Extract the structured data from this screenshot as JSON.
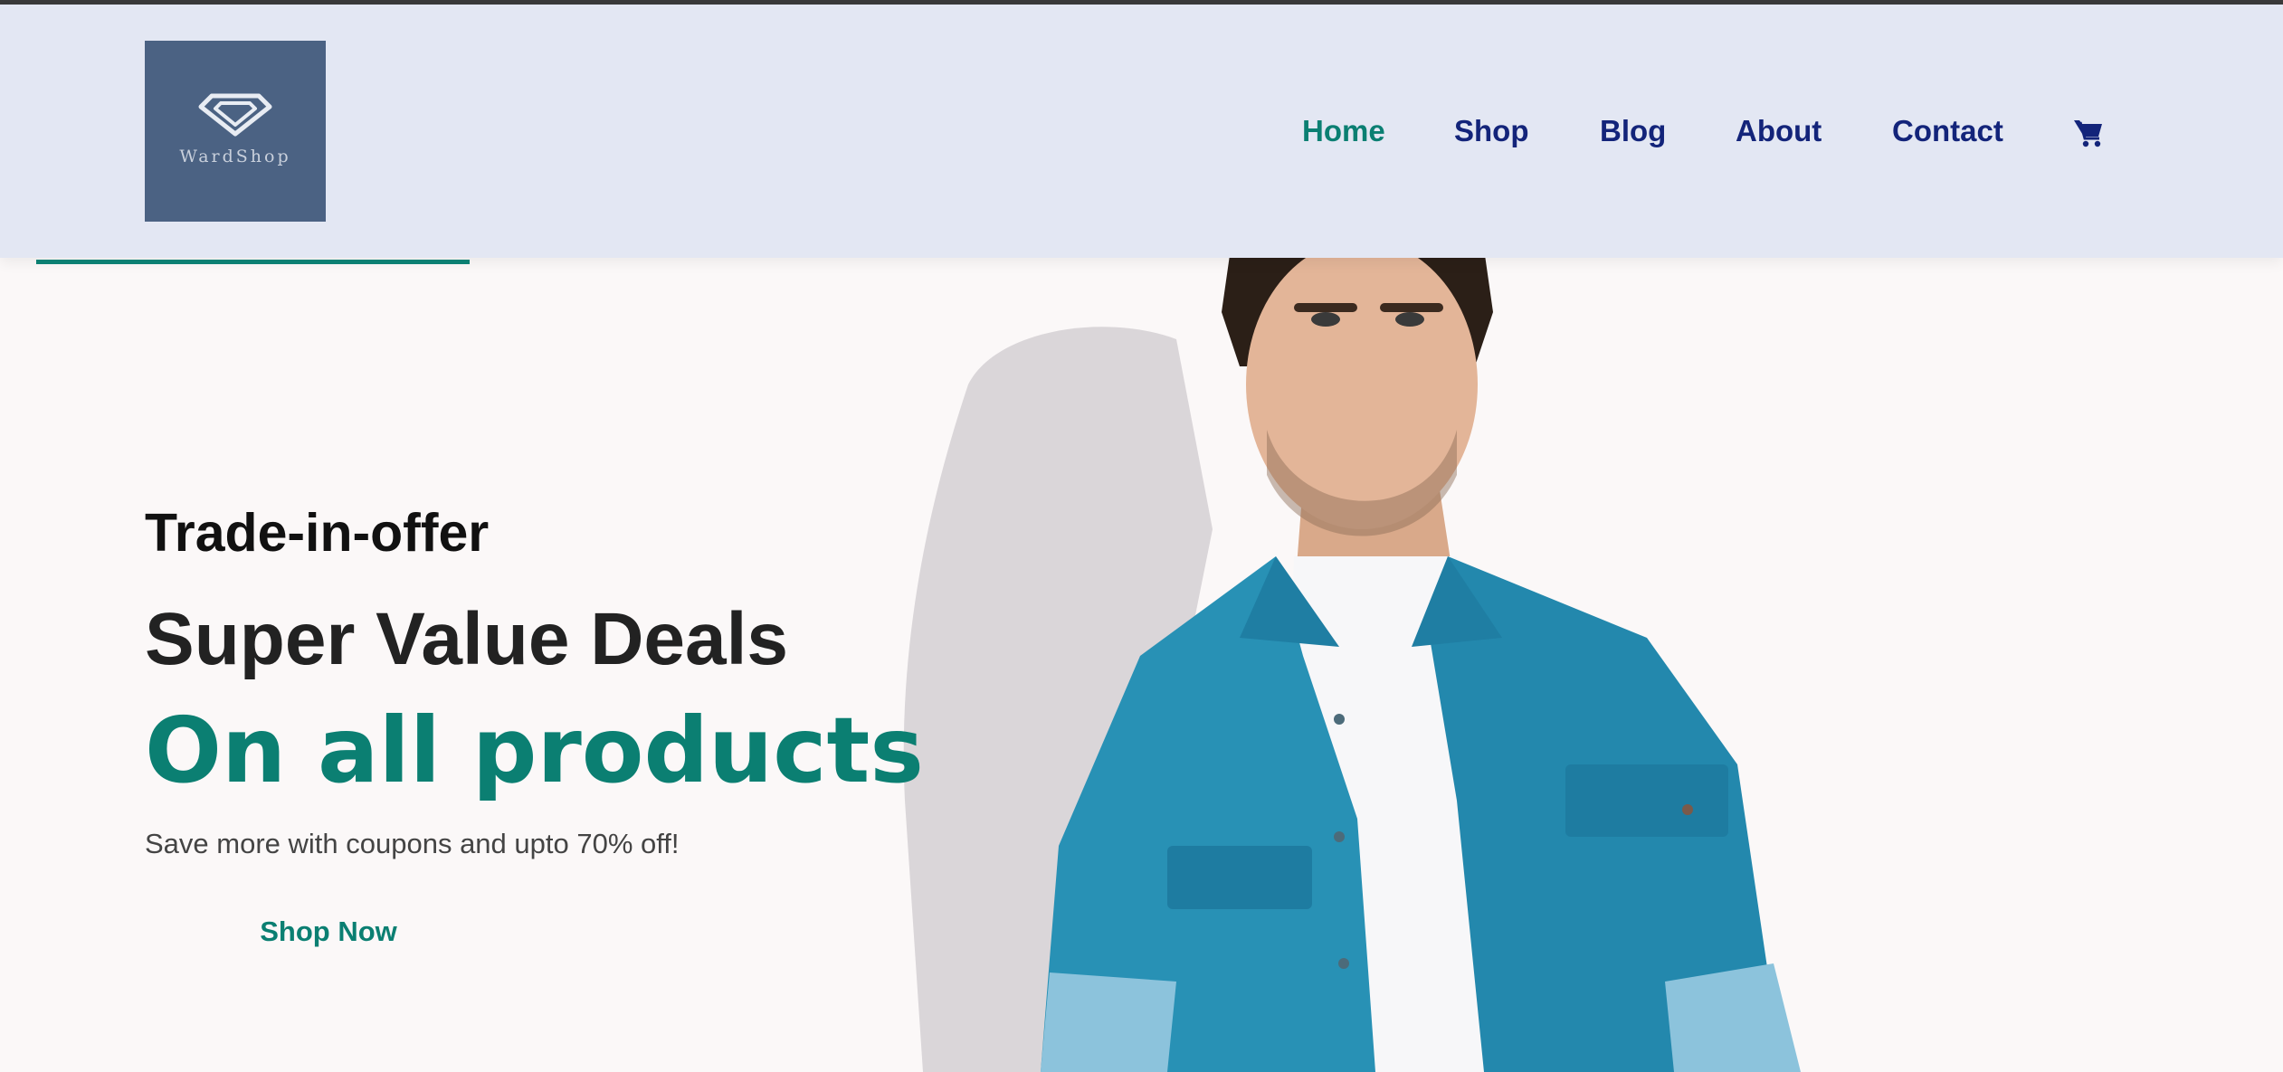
{
  "brand": {
    "name": "WardShop",
    "logo_icon": "diamond-icon",
    "logo_bg": "#4b6283"
  },
  "nav": {
    "items": [
      {
        "label": "Home",
        "active": true
      },
      {
        "label": "Shop",
        "active": false
      },
      {
        "label": "Blog",
        "active": false
      },
      {
        "label": "About",
        "active": false
      },
      {
        "label": "Contact",
        "active": false
      }
    ],
    "cart_icon": "cart-icon"
  },
  "page_progress": 0.19,
  "hero": {
    "eyebrow": "Trade-in-offer",
    "title": "Super Value Deals",
    "title_accent": "On all products",
    "description": "Save more with coupons and upto 70% off!",
    "cta_label": "Shop Now",
    "image_subject": "man in denim shirt"
  },
  "colors": {
    "accent": "#0b7f72",
    "nav_text": "#13247a",
    "header_bg": "#e3e7f3",
    "hero_bg": "#fbf8f8"
  }
}
